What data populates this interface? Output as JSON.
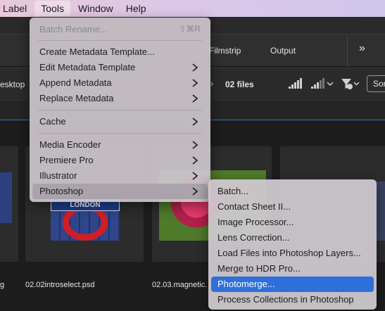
{
  "menubar": {
    "items": [
      "Label",
      "Tools",
      "Window",
      "Help"
    ],
    "active": "Tools"
  },
  "workspace": {
    "filmstrip": "Filmstrip",
    "output": "Output",
    "more": "»"
  },
  "pathbar": {
    "desktop": "esktop",
    "files": "02 files",
    "sort": "Sor"
  },
  "files": {
    "name1": "g",
    "name2": "02.02introselect.psd",
    "name3": "02.03.magnetic.",
    "sign": "LONDON"
  },
  "tools_menu": {
    "batch_rename": "Batch Rename...",
    "batch_rename_shortcut": "⇧⌘R",
    "create_metadata_template": "Create Metadata Template...",
    "edit_metadata_template": "Edit Metadata Template",
    "append_metadata": "Append Metadata",
    "replace_metadata": "Replace Metadata",
    "cache": "Cache",
    "media_encoder": "Media Encoder",
    "premiere_pro": "Premiere Pro",
    "illustrator": "Illustrator",
    "photoshop": "Photoshop"
  },
  "photoshop_submenu": {
    "batch": "Batch...",
    "contact_sheet": "Contact Sheet II...",
    "image_processor": "Image Processor...",
    "lens_correction": "Lens Correction...",
    "load_files": "Load Files into Photoshop Layers...",
    "merge_hdr": "Merge to HDR Pro...",
    "photomerge": "Photomerge...",
    "process_collections": "Process Collections in Photoshop"
  },
  "colors": {
    "selection": "#2f6fd9",
    "menu_bg": "#ccc6cc"
  }
}
